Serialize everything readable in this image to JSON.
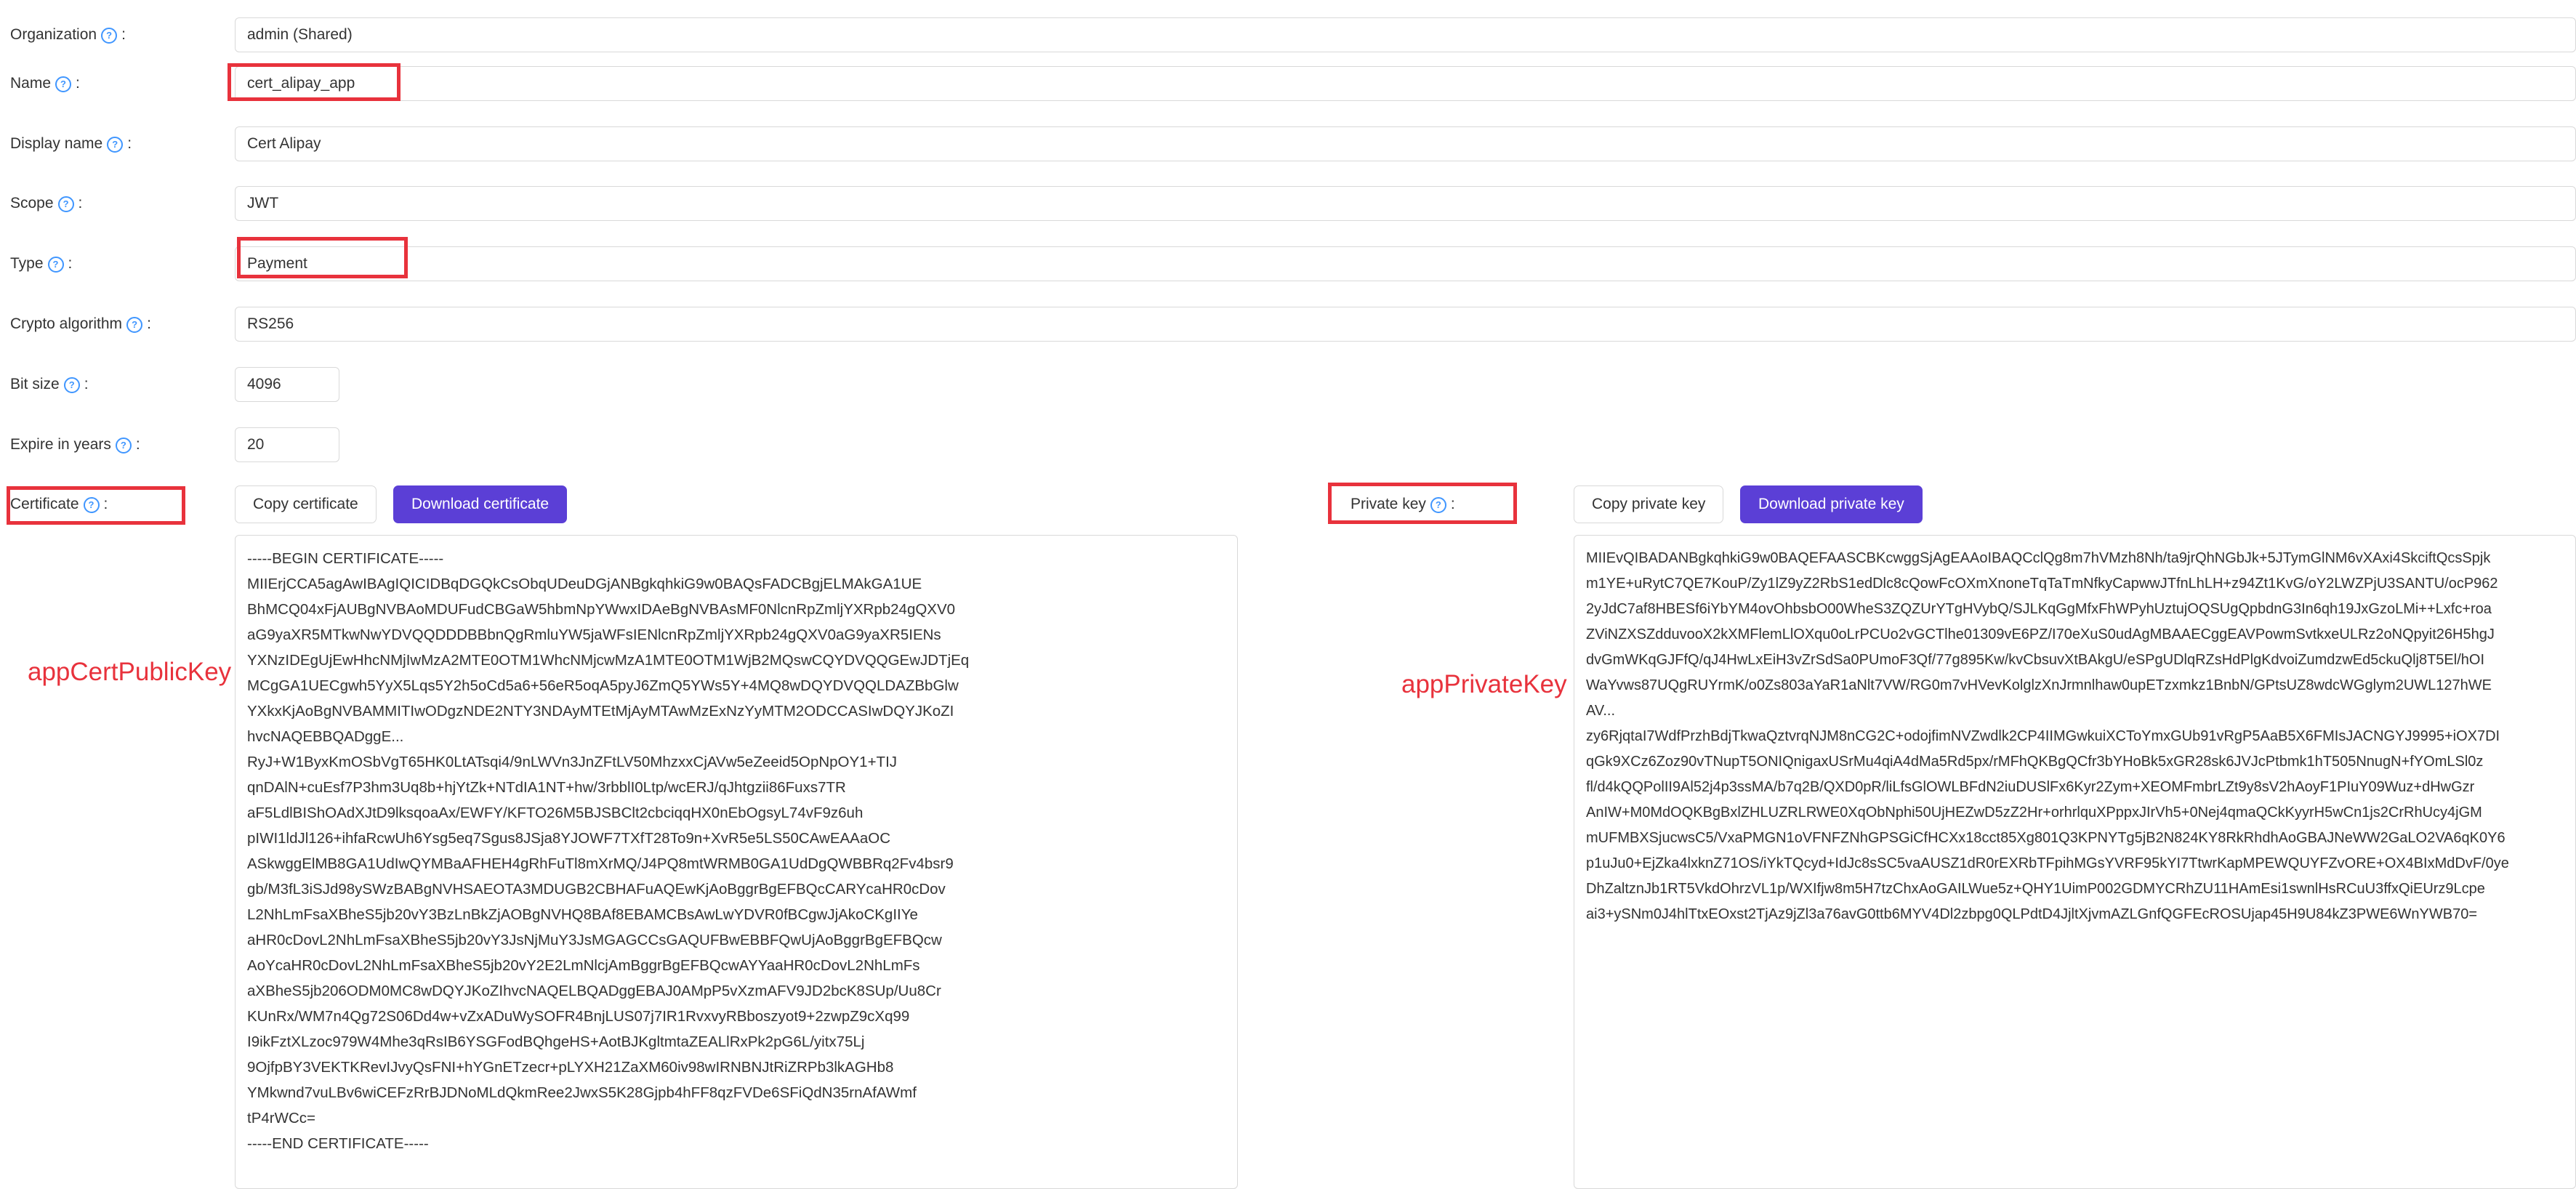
{
  "form": {
    "organization": {
      "label": "Organization",
      "value": "admin (Shared)"
    },
    "name": {
      "label": "Name",
      "value": "cert_alipay_app"
    },
    "display_name": {
      "label": "Display name",
      "value": "Cert Alipay"
    },
    "scope": {
      "label": "Scope",
      "value": "JWT"
    },
    "type": {
      "label": "Type",
      "value": "Payment"
    },
    "crypto_algorithm": {
      "label": "Crypto algorithm",
      "value": "RS256"
    },
    "bit_size": {
      "label": "Bit size",
      "value": "4096"
    },
    "expire_in_years": {
      "label": "Expire in years",
      "value": "20"
    }
  },
  "certificate": {
    "label": "Certificate",
    "copy_button": "Copy certificate",
    "download_button": "Download certificate",
    "annotation": "appCertPublicKey",
    "content": "-----BEGIN CERTIFICATE-----\nMIIErjCCA5agAwIBAgIQICIDBqDGQkCsObqUDeuDGjANBgkqhkiG9w0BAQsFADCBgjELMAkGA1UE\nBhMCQ04xFjAUBgNVBAoMDUFudCBGaW5hbmNpYWwxIDAeBgNVBAsMF0NlcnRpZmljYXRpb24gQXV0\naG9yaXR5MTkwNwYDVQQDDDBBbnQgRmluYW5jaWFsIENlcnRpZmljYXRpb24gQXV0aG9yaXR5IENs\nYXNzIDEgUjEwHhcNMjIwMzA2MTE0OTM1WhcNMjcwMzA1MTE0OTM1WjB2MQswCQYDVQQGEwJDTjEq\nMCgGA1UECgwh5YyX5Lqs5Y2h5oCd5a6+56eR5oqA5pyJ6ZmQ5YWs5Y+4MQ8wDQYDVQQLDAZBbGlw\nYXkxKjAoBgNVBAMMITIwODgzNDE2NTY3NDAyMTEtMjAyMTAwMzExNzYyMTM2ODCCASIwDQYJKoZI\nhvcNAQEBBQADggE...\nRyJ+W1ByxKmOSbVgT65HK0LtATsqi4/9nLWVn3JnZFtLV50MhzxxCjAVw5eZeeid5OpNpOY1+TIJ\nqnDAlN+cuEsf7P3hm3Uq8b+hjYtZk+NTdIA1NT+hw/3rbblI0Ltp/wcERJ/qJhtgzii86Fuxs7TR\naF5LdlBIShOAdXJtD9lksqoaAx/EWFY/KFTO26M5BJSBClt2cbciqqHX0nEbOgsyL74vF9z6uh\npIWI1ldJl126+ihfaRcwUh6Ysg5eq7Sgus8JSja8YJOWF7TXfT28To9n+XvR5e5LS50CAwEAAaOC\nASkwggElMB8GA1UdIwQYMBaAFHEH4gRhFuTl8mXrMQ/J4PQ8mtWRMB0GA1UdDgQWBBRq2Fv4bsr9\ngb/M3fL3iSJd98ySWzBABgNVHSAEOTA3MDUGB2CBHAFuAQEwKjAoBggrBgEFBQcCARYcaHR0cDov\nL2NhLmFsaXBheS5jb20vY3BzLnBkZjAOBgNVHQ8BAf8EBAMCBsAwLwYDVR0fBCgwJjAkoCKgIIYe\naHR0cDovL2NhLmFsaXBheS5jb20vY3JsNjMuY3JsMGAGCCsGAQUFBwEBBFQwUjAoBggrBgEFBQcw\nAoYcaHR0cDovL2NhLmFsaXBheS5jb20vY2E2LmNlcjAmBggrBgEFBQcwAYYaaHR0cDovL2NhLmFs\naXBheS5jb206ODM0MC8wDQYJKoZIhvcNAQELBQADggEBAJ0AMpP5vXzmAFV9JD2bcK8SUp/Uu8Cr\nKUnRx/WM7n4Qg72S06Dd4w+vZxADuWySOFR4BnjLUS07j7IR1RvxvyRBboszyot9+2zwpZ9cXq99\nI9ikFztXLzoc979W4Mhe3qRsIB6YSGFodBQhgeHS+AotBJKgltmtaZEALlRxPk2pG6L/yitx75Lj\n9OjfpBY3VEKTKRevIJvyQsFNI+hYGnETzecr+pLYXH21ZaXM60iv98wIRNBNJtRiZRPb3lkAGHb8\nYMkwnd7vuLBv6wiCEFzRrBJDNoMLdQkmRee2JwxS5K28Gjpb4hFF8qzFVDe6SFiQdN35rnAfAWmf\ntP4rWCc=\n-----END CERTIFICATE-----"
  },
  "private_key": {
    "label": "Private key",
    "copy_button": "Copy private key",
    "download_button": "Download private key",
    "annotation": "appPrivateKey",
    "content": "MIIEvQIBADANBgkqhkiG9w0BAQEFAASCBKcwggSjAgEAAoIBAQCclQg8m7hVMzh8Nh/ta9jrQhNGbJk+5JTymGlNM6vXAxi4SkciftQcsSpjk\nm1YE+uRytC7QE7KouP/Zy1lZ9yZ2RbS1edDlc8cQowFcOXmXnoneTqTaTmNfkyCapwwJTfnLhLH+z94Zt1KvG/oY2LWZPjU3SANTU/ocP962\n2yJdC7af8HBESf6iYbYM4ovOhbsbO00WheS3ZQZUrYTgHVybQ/SJLKqGgMfxFhWPyhUztujOQSUgQpbdnG3In6qh19JxGzoLMi++Lxfc+roa\nZViNZXSZdduvooX2kXMFlemLlOXqu0oLrPCUo2vGCTlhe01309vE6PZ/I70eXuS0udAgMBAAECggEAVPowmSvtkxeULRz2oNQpyit26H5hgJ\ndvGmWKqGJFfQ/qJ4HwLxEiH3vZrSdSa0PUmoF3Qf/77g895Kw/kvCbsuvXtBAkgU/eSPgUDlqRZsHdPlgKdvoiZumdzwEd5ckuQlj8T5El/hOI\nWaYvws87UQgRUYrmK/o0Zs803aYaR1aNlt7VW/RG0m7vHVevKolglzXnJrmnlhaw0upETzxmkz1BnbN/GPtsUZ8wdcWGglym2UWL127hWE\nAV...\nzy6RjqtaI7WdfPrzhBdjTkwaQztvrqNJM8nCG2C+odojfimNVZwdlk2CP4IIMGwkuiXCToYmxGUb91vRgP5AaB5X6FMIsJACNGYJ9995+iOX7DI\nqGk9XCz6Zoz90vTNupT5ONIQnigaxUSrMu4qiA4dMa5Rd5px/rMFhQKBgQCfr3bYHoBk5xGR28sk6JVJcPtbmk1hT505NnugN+fYOmLSl0z\nfl/d4kQQPolII9Al52j4p3ssMA/b7q2B/QXD0pR/liLfsGlOWLBFdN2iuDUSlFx6Kyr2Zym+XEOMFmbrLZt9y8sV2hAoyF1PIuY09Wuz+dHwGzr\nAnIW+M0MdOQKBgBxlZHLUZRLRWE0XqObNphi50UjHEZwD5zZ2Hr+orhrlquXPppxJIrVh5+0Nej4qmaQCkKyyrH5wCn1js2CrRhUcy4jGM\nmUFMBXSjucwsC5/VxaPMGN1oVFNFZNhGPSGiCfHCXx18cct85Xg801Q3KPNYTg5jB2N824KY8RkRhdhAoGBAJNeWW2GaLO2VA6qK0Y6\np1uJu0+EjZka4lxknZ71OS/iYkTQcyd+IdJc8sSC5vaAUSZ1dR0rEXRbTFpihMGsYVRF95kYI7TtwrKapMPEWQUYFZvORE+OX4BIxMdDvF/0ye\nDhZaltznJb1RT5VkdOhrzVL1p/WXIfjw8m5H7tzChxAoGAILWue5z+QHY1UimP002GDMYCRhZU11HAmEsi1swnlHsRCuU3ffxQiEUrz9Lcpe\nai3+ySNm0J4hlTtxEOxst2TjAz9jZl3a76avG0ttb6MYV4Dl2zbpg0QLPdtD4JjltXjvmAZLGnfQGFEcROSUjap45H9U84kZ3PWE6WnYWB70="
  }
}
